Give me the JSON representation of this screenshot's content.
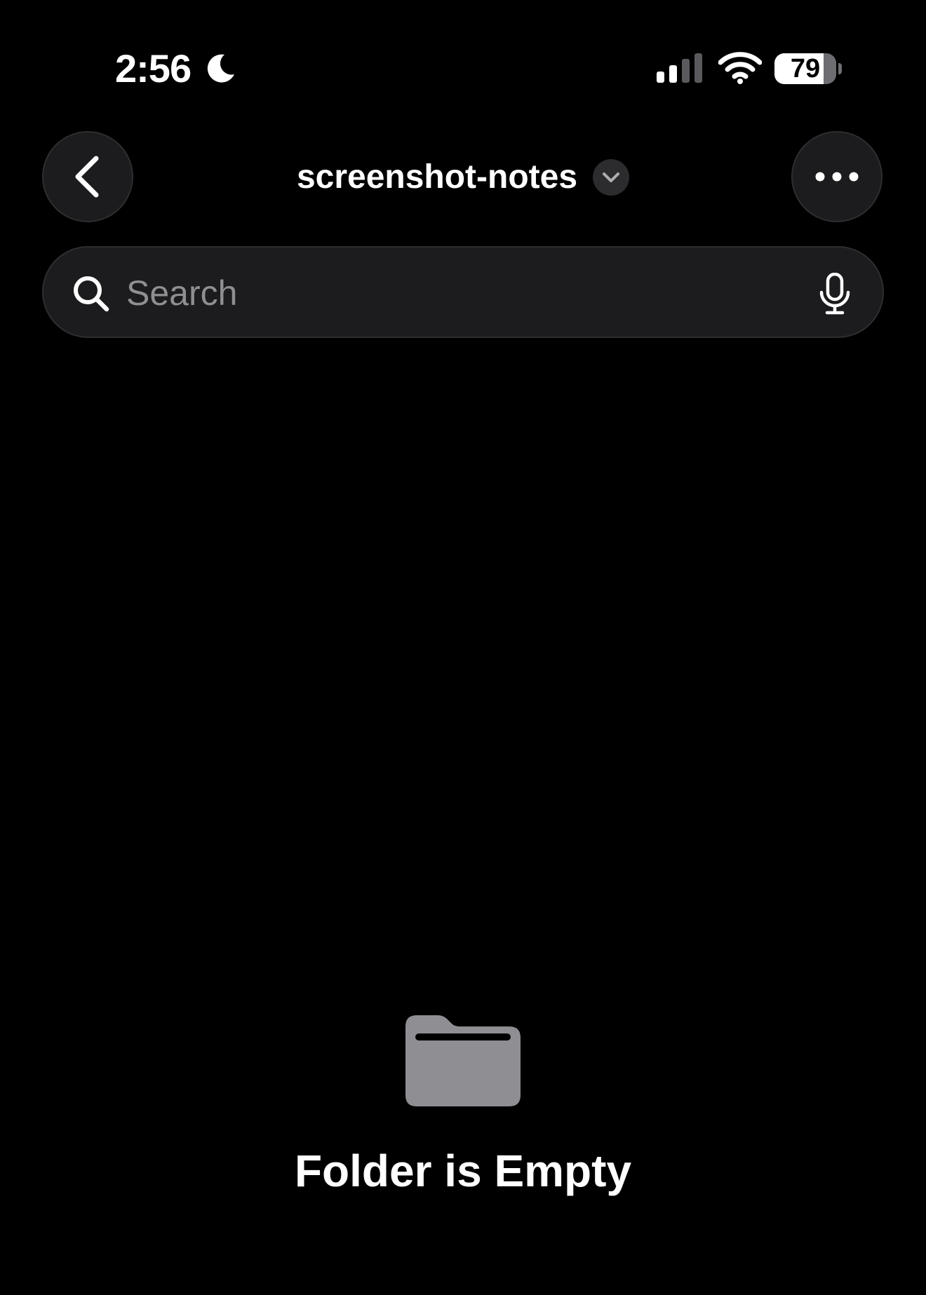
{
  "status_bar": {
    "time": "2:56",
    "battery_level": "79",
    "battery_fraction": 0.79,
    "icons": [
      "moon-icon",
      "cellular-signal-icon",
      "wifi-icon",
      "battery-icon"
    ]
  },
  "nav": {
    "title": "screenshot-notes",
    "back_icon": "chevron-left-icon",
    "title_menu_icon": "chevron-down-icon",
    "more_icon": "ellipsis-icon"
  },
  "search": {
    "placeholder": "Search",
    "value": "",
    "search_icon": "magnifying-glass-icon",
    "dictation_icon": "microphone-icon"
  },
  "empty_state": {
    "icon": "folder-icon",
    "title": "Folder is Empty"
  },
  "colors": {
    "background": "#000000",
    "control_fill": "#1c1c1e",
    "control_border": "#2e2e30",
    "placeholder": "#8e8e93",
    "folder_icon": "#8e8e93",
    "text": "#ffffff"
  }
}
